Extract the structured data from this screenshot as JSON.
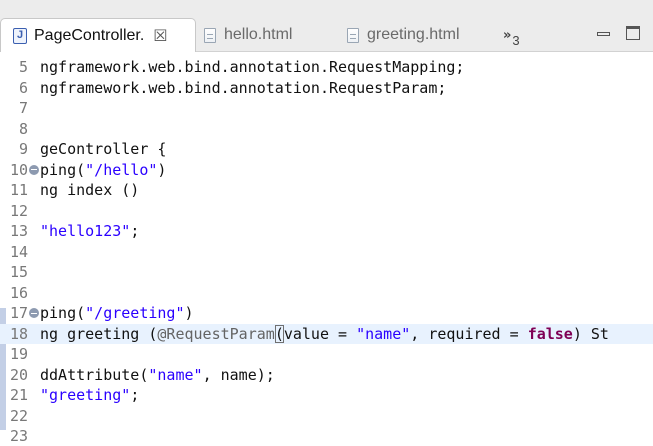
{
  "tabs": [
    {
      "label": "PageController.",
      "icon": "java-file-icon",
      "active": true
    },
    {
      "label": "hello.html",
      "icon": "html-file-icon",
      "active": false
    },
    {
      "label": "greeting.html",
      "icon": "html-file-icon",
      "active": false
    }
  ],
  "tab_close_glyph": "☒",
  "java_icon_letter": "J",
  "overflow": {
    "chevron": "»",
    "count": "3"
  },
  "window_controls": [
    "minimize-icon",
    "maximize-icon"
  ],
  "code_lines": [
    {
      "num": "5",
      "fold": false,
      "tokens": [
        {
          "t": "ngframework.web.bind.annotation.RequestMapping;",
          "c": "code"
        }
      ]
    },
    {
      "num": "6",
      "fold": false,
      "tokens": [
        {
          "t": "ngframework.web.bind.annotation.RequestParam;",
          "c": "code"
        }
      ]
    },
    {
      "num": "7",
      "fold": false,
      "tokens": []
    },
    {
      "num": "8",
      "fold": false,
      "tokens": []
    },
    {
      "num": "9",
      "fold": false,
      "tokens": [
        {
          "t": "geController {",
          "c": "code"
        }
      ]
    },
    {
      "num": "10",
      "fold": true,
      "tokens": [
        {
          "t": "ping(",
          "c": "code"
        },
        {
          "t": "\"/hello\"",
          "c": "str"
        },
        {
          "t": ")",
          "c": "code"
        }
      ]
    },
    {
      "num": "11",
      "fold": false,
      "tokens": [
        {
          "t": "ng index ()",
          "c": "code"
        }
      ]
    },
    {
      "num": "12",
      "fold": false,
      "tokens": []
    },
    {
      "num": "13",
      "fold": false,
      "tokens": [
        {
          "t": "\"hello123\"",
          "c": "str"
        },
        {
          "t": ";",
          "c": "code"
        }
      ]
    },
    {
      "num": "14",
      "fold": false,
      "tokens": []
    },
    {
      "num": "15",
      "fold": false,
      "tokens": []
    },
    {
      "num": "16",
      "fold": false,
      "tokens": []
    },
    {
      "num": "17",
      "fold": true,
      "tokens": [
        {
          "t": "ping(",
          "c": "code"
        },
        {
          "t": "\"/greeting\"",
          "c": "str"
        },
        {
          "t": ")",
          "c": "code"
        }
      ]
    },
    {
      "num": "18",
      "fold": false,
      "current": true,
      "tokens": [
        {
          "t": "ng greeting (",
          "c": "code"
        },
        {
          "t": "@RequestParam",
          "c": "ann"
        },
        {
          "t": "(",
          "c": "bracket"
        },
        {
          "t": "value = ",
          "c": "code"
        },
        {
          "t": "\"name\"",
          "c": "str"
        },
        {
          "t": ", required = ",
          "c": "code"
        },
        {
          "t": "false",
          "c": "kw"
        },
        {
          "t": ") St",
          "c": "code"
        }
      ]
    },
    {
      "num": "19",
      "fold": false,
      "tokens": []
    },
    {
      "num": "20",
      "fold": false,
      "tokens": [
        {
          "t": "ddAttribute(",
          "c": "code"
        },
        {
          "t": "\"name\"",
          "c": "str"
        },
        {
          "t": ", name);",
          "c": "code"
        }
      ]
    },
    {
      "num": "21",
      "fold": false,
      "tokens": [
        {
          "t": "\"greeting\"",
          "c": "str"
        },
        {
          "t": ";",
          "c": "code"
        }
      ]
    },
    {
      "num": "22",
      "fold": false,
      "tokens": []
    },
    {
      "num": "23",
      "fold": false,
      "tokens": []
    }
  ],
  "colors": {
    "string": "#2a00ff",
    "keyword": "#7f0055",
    "annotation": "#646464",
    "line_number": "#787878",
    "current_line": "#e8f2fe",
    "ruler_mark": "#c3cfe6"
  }
}
